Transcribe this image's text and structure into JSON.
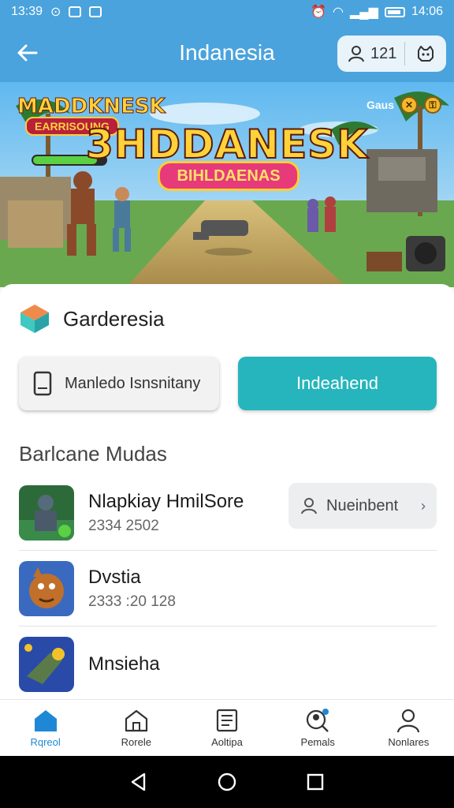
{
  "status_bar": {
    "time": "13:39",
    "right_time": "14:06"
  },
  "app_bar": {
    "title": "Indanesia",
    "count": "121"
  },
  "banner": {
    "logo": "MADDKNESK",
    "logo_sub": "EARRISOUNG",
    "title": "3HDDANESK",
    "subtitle": "BIHLDAENAS",
    "gems_label": "Gaus"
  },
  "app": {
    "name": "Garderesia"
  },
  "buttons": {
    "secondary_label": "Manledo Isnsnitany",
    "primary_label": "Indeahend"
  },
  "section": {
    "title": "Barlcane Mudas"
  },
  "list": [
    {
      "title": "Nlapkiay HmilSore",
      "sub": "2334 2502",
      "button": "Nueinbent"
    },
    {
      "title": "Dvstia",
      "sub": "2333 :20 128"
    },
    {
      "title": "Mnsieha"
    }
  ],
  "bottom_nav": [
    {
      "label": "Rqreol",
      "icon": "home-filled-icon"
    },
    {
      "label": "Rorele",
      "icon": "home-outline-icon"
    },
    {
      "label": "Aoltipa",
      "icon": "list-icon"
    },
    {
      "label": "Pemals",
      "icon": "search-person-icon"
    },
    {
      "label": "Nonlares",
      "icon": "profile-icon"
    }
  ],
  "colors": {
    "accent": "#4aa3dd",
    "primary": "#26b5bc",
    "active_nav": "#1e88d6"
  }
}
